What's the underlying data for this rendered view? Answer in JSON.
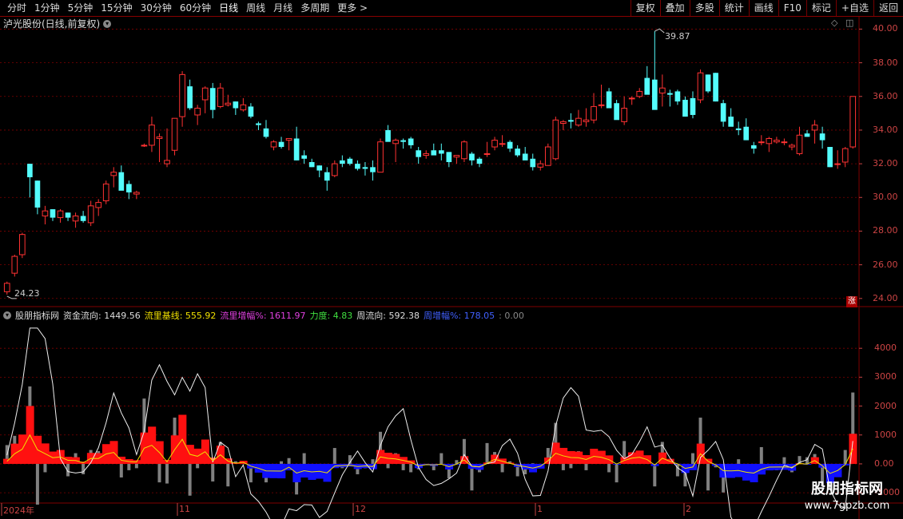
{
  "toolbar": {
    "periods": [
      "分时",
      "1分钟",
      "5分钟",
      "15分钟",
      "30分钟",
      "60分钟",
      "日线",
      "周线",
      "月线",
      "多周期",
      "更多"
    ],
    "active": "日线",
    "more_arrow": ">",
    "right_buttons": [
      "复权",
      "叠加",
      "多股",
      "统计",
      "画线",
      "F10",
      "标记",
      "+自选",
      "返回"
    ]
  },
  "main_chart": {
    "title": "泸光股份(日线,前复权)",
    "y_ticks": [
      "40.00",
      "38.00",
      "36.00",
      "34.00",
      "32.00",
      "30.00",
      "28.00",
      "26.00",
      "24.00"
    ],
    "max_label": "39.87",
    "min_label": "24.23",
    "corner_badge": "涨"
  },
  "indicator": {
    "name": "股朋指标网",
    "items": [
      {
        "label": "资金流向:",
        "value": "1449.56",
        "color": "#dddddd"
      },
      {
        "label": "流里基线:",
        "value": "555.92",
        "color": "#f0e000"
      },
      {
        "label": "流里增幅%:",
        "value": "1611.97",
        "color": "#e040e0"
      },
      {
        "label": "力度:",
        "value": "4.83",
        "color": "#40e040"
      },
      {
        "label": "周流向:",
        "value": "592.38",
        "color": "#dddddd"
      },
      {
        "label": "周增幅%:",
        "value": "178.05",
        "color": "#4060ff"
      },
      {
        "label": ":",
        "value": "0.00",
        "color": "#888888"
      }
    ],
    "y_ticks": [
      "4000",
      "3000",
      "2000",
      "1000",
      "0.00",
      "-1000"
    ]
  },
  "x_axis": [
    "2024年",
    "11",
    "12",
    "1",
    "2"
  ],
  "watermark": {
    "name": "股朋指标网",
    "url": "www.7gpzb.com"
  },
  "colors": {
    "up": "#ff3232",
    "down": "#54fcfc",
    "grid": "#800000",
    "axis": "#c44444"
  },
  "chart_data": {
    "type": "candlestick",
    "candles": [
      [
        24.4,
        25.0,
        24.23,
        24.9
      ],
      [
        25.5,
        26.6,
        25.3,
        26.5
      ],
      [
        26.6,
        27.9,
        26.4,
        27.8
      ],
      [
        32.0,
        32.0,
        30.0,
        31.2
      ],
      [
        31.0,
        31.0,
        29.0,
        29.4
      ],
      [
        28.9,
        29.5,
        28.4,
        29.2
      ],
      [
        29.3,
        29.3,
        28.6,
        28.8
      ],
      [
        28.8,
        29.3,
        28.5,
        29.2
      ],
      [
        29.1,
        29.1,
        28.6,
        28.8
      ],
      [
        28.6,
        29.1,
        28.2,
        28.9
      ],
      [
        28.9,
        29.2,
        28.5,
        28.6
      ],
      [
        28.5,
        29.8,
        28.3,
        29.5
      ],
      [
        29.4,
        29.9,
        28.9,
        29.7
      ],
      [
        29.8,
        31.0,
        29.6,
        30.8
      ],
      [
        31.3,
        31.8,
        30.6,
        31.5
      ],
      [
        31.5,
        31.9,
        30.8,
        30.4
      ],
      [
        30.8,
        31.0,
        29.9,
        30.3
      ],
      [
        30.2,
        30.4,
        29.9,
        30.3
      ],
      [
        33.1,
        33.2,
        33.0,
        33.1
      ],
      [
        33.1,
        34.8,
        32.7,
        34.3
      ],
      [
        33.5,
        33.8,
        32.1,
        33.6
      ],
      [
        32.0,
        34.1,
        31.8,
        32.2
      ],
      [
        32.8,
        34.5,
        32.5,
        34.7
      ],
      [
        34.8,
        37.5,
        34.2,
        37.3
      ],
      [
        36.6,
        37.0,
        35.2,
        35.3
      ],
      [
        34.9,
        35.5,
        34.3,
        35.3
      ],
      [
        35.8,
        36.6,
        35.0,
        36.5
      ],
      [
        36.5,
        36.8,
        34.7,
        35.2
      ],
      [
        35.4,
        36.8,
        35.3,
        36.5
      ],
      [
        35.5,
        36.1,
        35.4,
        35.6
      ],
      [
        35.7,
        35.7,
        34.9,
        35.3
      ],
      [
        35.2,
        35.9,
        35.1,
        35.5
      ],
      [
        35.4,
        35.6,
        34.7,
        34.8
      ],
      [
        34.4,
        34.5,
        34.0,
        34.3
      ],
      [
        34.1,
        34.6,
        33.5,
        33.6
      ],
      [
        33.0,
        33.4,
        32.8,
        33.3
      ],
      [
        33.3,
        33.6,
        32.9,
        33.0
      ],
      [
        33.4,
        33.5,
        32.8,
        33.5
      ],
      [
        33.5,
        34.2,
        32.2,
        32.2
      ],
      [
        32.5,
        32.8,
        32.0,
        32.3
      ],
      [
        32.1,
        32.3,
        31.8,
        31.8
      ],
      [
        31.9,
        31.9,
        31.2,
        31.6
      ],
      [
        31.5,
        31.8,
        30.4,
        31.0
      ],
      [
        31.3,
        32.2,
        31.2,
        32.0
      ],
      [
        32.2,
        32.5,
        31.8,
        32.0
      ],
      [
        32.3,
        32.4,
        31.9,
        32.0
      ],
      [
        32.0,
        32.2,
        31.6,
        31.7
      ],
      [
        31.8,
        32.1,
        31.3,
        31.7
      ],
      [
        31.8,
        32.2,
        31.0,
        31.5
      ],
      [
        31.5,
        33.5,
        31.5,
        33.3
      ],
      [
        34.0,
        34.3,
        33.4,
        33.3
      ],
      [
        33.2,
        33.5,
        32.1,
        33.4
      ],
      [
        33.4,
        33.5,
        32.9,
        33.3
      ],
      [
        33.5,
        33.6,
        32.9,
        33.1
      ],
      [
        32.8,
        33.0,
        32.0,
        32.4
      ],
      [
        32.5,
        32.8,
        32.3,
        32.6
      ],
      [
        32.8,
        33.2,
        32.6,
        32.5
      ],
      [
        32.8,
        33.2,
        32.2,
        32.6
      ],
      [
        32.7,
        32.7,
        31.8,
        32.1
      ],
      [
        32.4,
        32.4,
        32.0,
        32.5
      ],
      [
        32.3,
        33.4,
        32.1,
        33.3
      ],
      [
        32.6,
        32.7,
        31.9,
        32.2
      ],
      [
        32.3,
        32.4,
        31.8,
        32.0
      ],
      [
        32.6,
        33.3,
        32.4,
        32.6
      ],
      [
        33.0,
        33.6,
        32.8,
        33.4
      ],
      [
        33.2,
        33.7,
        33.0,
        33.2
      ],
      [
        33.3,
        33.4,
        32.7,
        32.9
      ],
      [
        32.9,
        33.1,
        32.4,
        32.5
      ],
      [
        32.6,
        33.0,
        32.3,
        32.2
      ],
      [
        32.3,
        32.6,
        31.6,
        31.8
      ],
      [
        31.8,
        32.2,
        31.6,
        32.0
      ],
      [
        31.9,
        33.2,
        31.9,
        33.0
      ],
      [
        32.3,
        34.8,
        32.2,
        34.6
      ],
      [
        34.4,
        34.6,
        34.0,
        34.5
      ],
      [
        34.6,
        35.0,
        34.1,
        34.5
      ],
      [
        34.3,
        35.2,
        34.2,
        34.7
      ],
      [
        34.5,
        35.3,
        34.2,
        34.6
      ],
      [
        34.6,
        36.2,
        34.4,
        35.4
      ],
      [
        35.5,
        36.7,
        35.3,
        35.5
      ],
      [
        36.3,
        36.5,
        35.9,
        35.3
      ],
      [
        35.6,
        35.8,
        35.1,
        34.6
      ],
      [
        34.5,
        36.0,
        34.3,
        35.3
      ],
      [
        35.9,
        36.0,
        35.5,
        35.9
      ],
      [
        36.0,
        36.5,
        35.9,
        36.3
      ],
      [
        37.1,
        37.8,
        36.9,
        36.1
      ],
      [
        37.0,
        39.87,
        35.9,
        35.2
      ],
      [
        36.2,
        37.3,
        35.4,
        36.5
      ],
      [
        36.2,
        36.4,
        35.4,
        36.1
      ],
      [
        36.3,
        36.4,
        35.5,
        35.7
      ],
      [
        35.8,
        36.0,
        34.8,
        34.8
      ],
      [
        35.9,
        36.3,
        34.7,
        34.9
      ],
      [
        35.8,
        37.6,
        35.6,
        37.4
      ],
      [
        37.3,
        37.3,
        36.2,
        36.3
      ],
      [
        37.4,
        37.4,
        35.7,
        35.7
      ],
      [
        35.6,
        35.8,
        34.2,
        34.5
      ],
      [
        34.8,
        35.3,
        34.6,
        34.2
      ],
      [
        34.1,
        34.5,
        33.7,
        34.0
      ],
      [
        34.2,
        34.7,
        33.4,
        33.4
      ],
      [
        33.1,
        33.3,
        32.6,
        32.9
      ],
      [
        33.3,
        33.7,
        33.1,
        33.3
      ],
      [
        33.2,
        33.6,
        32.7,
        33.5
      ],
      [
        33.3,
        33.6,
        33.2,
        33.4
      ],
      [
        33.3,
        33.5,
        33.1,
        33.3
      ],
      [
        33.0,
        33.2,
        32.8,
        33.1
      ],
      [
        32.6,
        34.2,
        32.5,
        33.7
      ],
      [
        33.8,
        34.0,
        33.6,
        33.6
      ],
      [
        34.0,
        34.6,
        33.2,
        34.3
      ],
      [
        33.8,
        34.2,
        32.9,
        33.4
      ],
      [
        33.0,
        33.0,
        31.8,
        31.8
      ],
      [
        32.0,
        32.8,
        31.7,
        32.0
      ],
      [
        32.1,
        33.0,
        31.8,
        32.9
      ],
      [
        33.0,
        36.0,
        32.9,
        36.0
      ]
    ],
    "flow_bars_desc": "red/blue bars per day; gray spikes per day; white/yellow/magenta lines",
    "ylim": [
      23.8,
      40.4
    ],
    "indicator_ylim": [
      -1300,
      5000
    ]
  }
}
